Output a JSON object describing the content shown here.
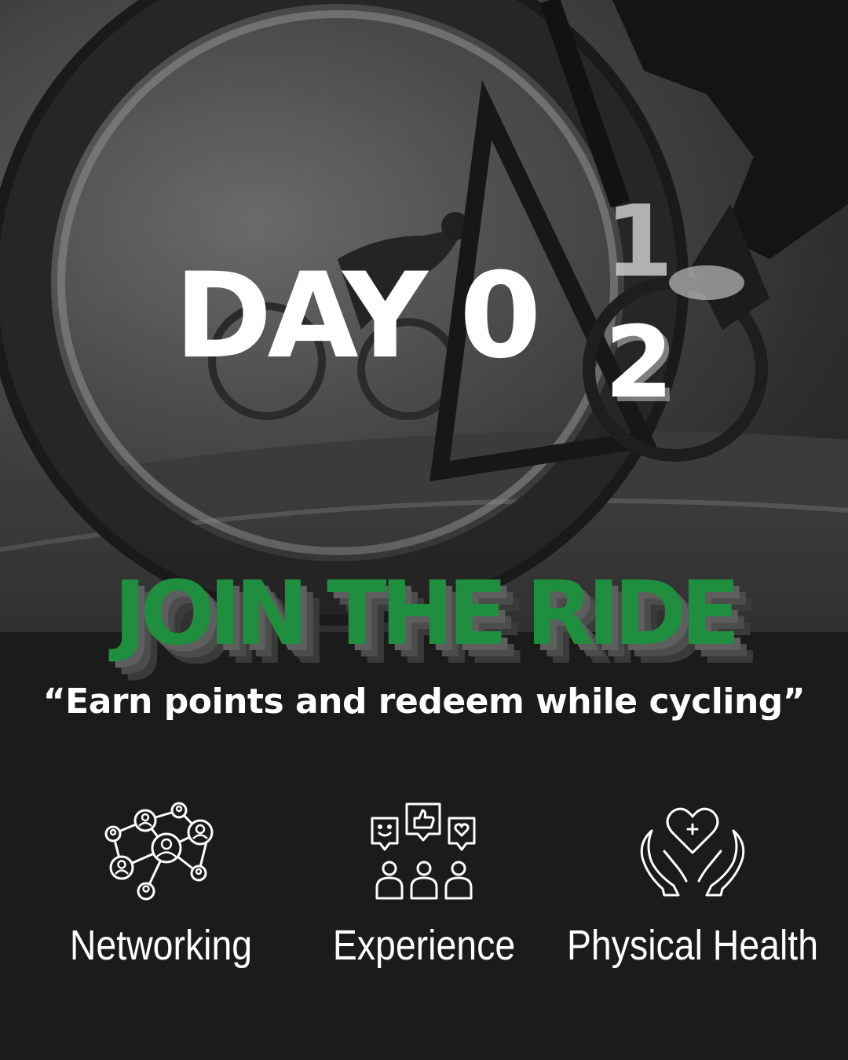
{
  "hero": {
    "day_label": "DAY 0",
    "day_from": "1",
    "day_to": "2"
  },
  "headline": "JOIN THE RIDE",
  "tagline": "“Earn points and redeem while cycling”",
  "features": [
    {
      "label": "Networking",
      "icon": "network-people-icon"
    },
    {
      "label": "Experience",
      "icon": "feedback-community-icon"
    },
    {
      "label": "Physical Health",
      "icon": "heart-in-hands-icon"
    }
  ],
  "colors": {
    "background": "#1b1b1b",
    "headline_green": "#1f8f3f",
    "text": "#ffffff"
  }
}
